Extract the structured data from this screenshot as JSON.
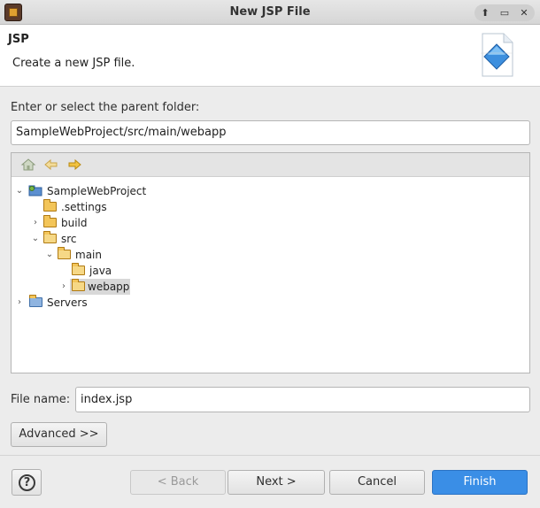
{
  "window": {
    "title": "New JSP File",
    "controls": {
      "up": "⬆",
      "minimize": "▭",
      "close": "✕"
    }
  },
  "banner": {
    "title": "JSP",
    "description": "Create a new JSP file."
  },
  "parent_folder": {
    "label": "Enter or select the parent folder:",
    "value": "SampleWebProject/src/main/webapp"
  },
  "tree": {
    "toolbar": [
      "home-icon",
      "back-arrow-icon",
      "forward-arrow-icon"
    ],
    "items": [
      {
        "label": "SampleWebProject",
        "expanded": true,
        "icon": "project-icon"
      },
      {
        "label": ".settings",
        "icon": "folder-icon"
      },
      {
        "label": "build",
        "expanded": false,
        "icon": "folder-icon"
      },
      {
        "label": "src",
        "expanded": true,
        "icon": "folder-open-icon"
      },
      {
        "label": "main",
        "expanded": true,
        "icon": "folder-open-icon"
      },
      {
        "label": "java",
        "icon": "folder-icon"
      },
      {
        "label": "webapp",
        "expanded": false,
        "selected": true,
        "icon": "folder-icon"
      },
      {
        "label": "Servers",
        "expanded": false,
        "icon": "servers-folder-icon"
      }
    ]
  },
  "file_name": {
    "label": "File name:",
    "value": "index.jsp"
  },
  "buttons": {
    "advanced": "Advanced >>",
    "back": "< Back",
    "next": "Next >",
    "cancel": "Cancel",
    "finish": "Finish",
    "help": "?"
  }
}
